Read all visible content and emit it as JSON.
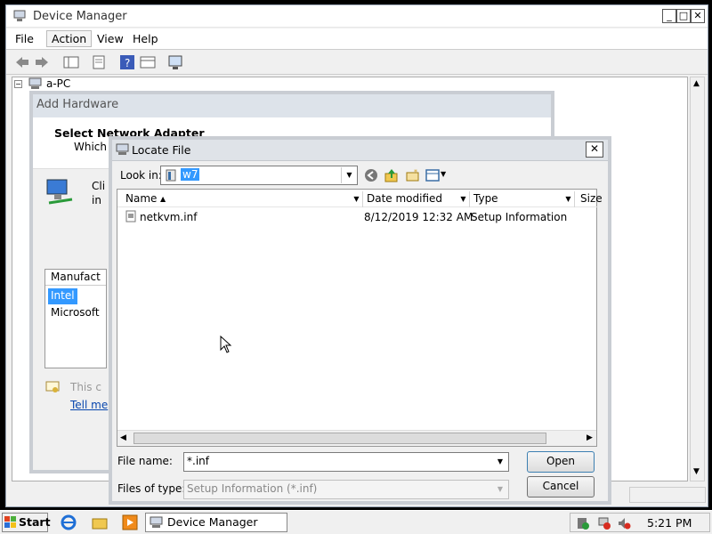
{
  "device_manager": {
    "title": "Device Manager",
    "menu": [
      "File",
      "Action",
      "View",
      "Help"
    ],
    "tree_root": "a-PC"
  },
  "add_hardware": {
    "title": "Add Hardware",
    "heading": "Select Network Adapter",
    "subtext": "Which",
    "click_text": "Cli",
    "click_text2": "in",
    "list_header": "Manufact",
    "list_items": [
      "Intel",
      "Microsoft"
    ],
    "bottom_text": "This c",
    "tell_me_link": "Tell me"
  },
  "locate_file": {
    "title": "Locate File",
    "look_in_label": "Look in:",
    "look_in_value": "w7",
    "columns": [
      "Name",
      "Date modified",
      "Type",
      "Size"
    ],
    "files": [
      {
        "name": "netkvm.inf",
        "date": "8/12/2019 12:32 AM",
        "type": "Setup Information"
      }
    ],
    "file_name_label": "File name:",
    "file_name_value": "*.inf",
    "files_of_type_label": "Files of type:",
    "files_of_type_value": "Setup Information (*.inf)",
    "open_label": "Open",
    "cancel_label": "Cancel"
  },
  "taskbar": {
    "start_label": "Start",
    "task_label": "Device Manager",
    "clock": "5:21 PM"
  },
  "icons": [
    "back-icon",
    "forward-icon",
    "computer-icon",
    "folder-icon",
    "network-adapter-icon",
    "cursor-icon"
  ]
}
